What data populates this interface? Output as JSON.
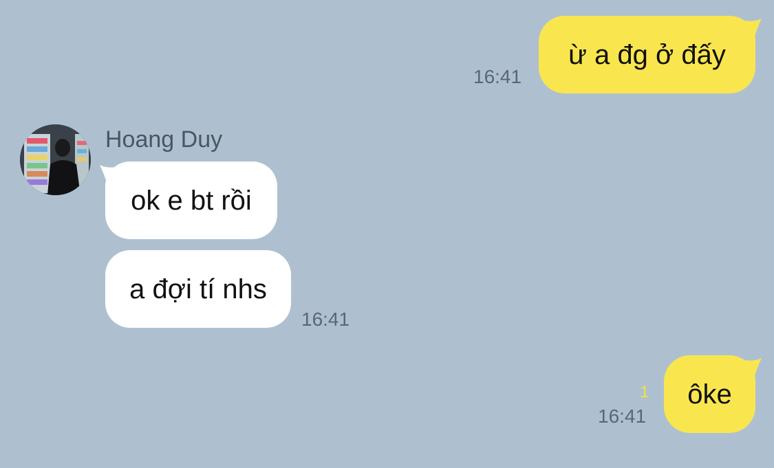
{
  "chat": {
    "messages": [
      {
        "from": "me",
        "text": "ừ a đg ở đấy",
        "time": "16:41"
      },
      {
        "from": "Hoang Duy",
        "text": "ok e bt rồi"
      },
      {
        "from": "Hoang Duy",
        "text": "a đợi tí nhs",
        "time": "16:41"
      },
      {
        "from": "me",
        "text": "ôke",
        "time": "16:41",
        "unread_count": "1"
      }
    ],
    "contact": {
      "name": "Hoang Duy",
      "avatar_icon": "profile-photo-avatar"
    },
    "colors": {
      "background": "#aec0d0",
      "my_bubble": "#f9e64f",
      "their_bubble": "#ffffff",
      "unread_counter": "#f2e042",
      "timestamp": "#5b6672"
    }
  }
}
